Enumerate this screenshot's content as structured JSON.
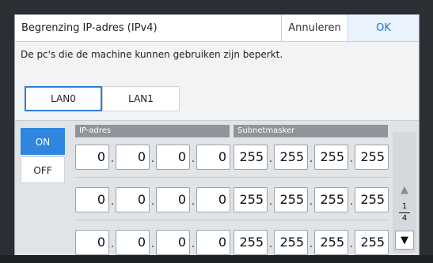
{
  "dialog": {
    "title": "Begrenzing IP-adres (IPv4)",
    "cancel_label": "Annuleren",
    "ok_label": "OK",
    "description": "De pc's die de machine kunnen gebruiken zijn beperkt."
  },
  "tabs": [
    {
      "label": "LAN0",
      "active": true
    },
    {
      "label": "LAN1",
      "active": false
    }
  ],
  "toggle": {
    "on_label": "ON",
    "off_label": "OFF",
    "selected": "ON"
  },
  "columns": {
    "ip": "IP-adres",
    "subnet": "Subnetmasker"
  },
  "rows": [
    {
      "ip": [
        "0",
        "0",
        "0",
        "0"
      ],
      "mask": [
        "255",
        "255",
        "255",
        "255"
      ]
    },
    {
      "ip": [
        "0",
        "0",
        "0",
        "0"
      ],
      "mask": [
        "255",
        "255",
        "255",
        "255"
      ]
    },
    {
      "ip": [
        "0",
        "0",
        "0",
        "0"
      ],
      "mask": [
        "255",
        "255",
        "255",
        "255"
      ]
    }
  ],
  "separator": ".",
  "pager": {
    "current": "1",
    "total": "4",
    "up_icon": "▲",
    "down_icon": "▼"
  },
  "colors": {
    "accent": "#2e86e0",
    "ok_text": "#1e6fd9"
  }
}
